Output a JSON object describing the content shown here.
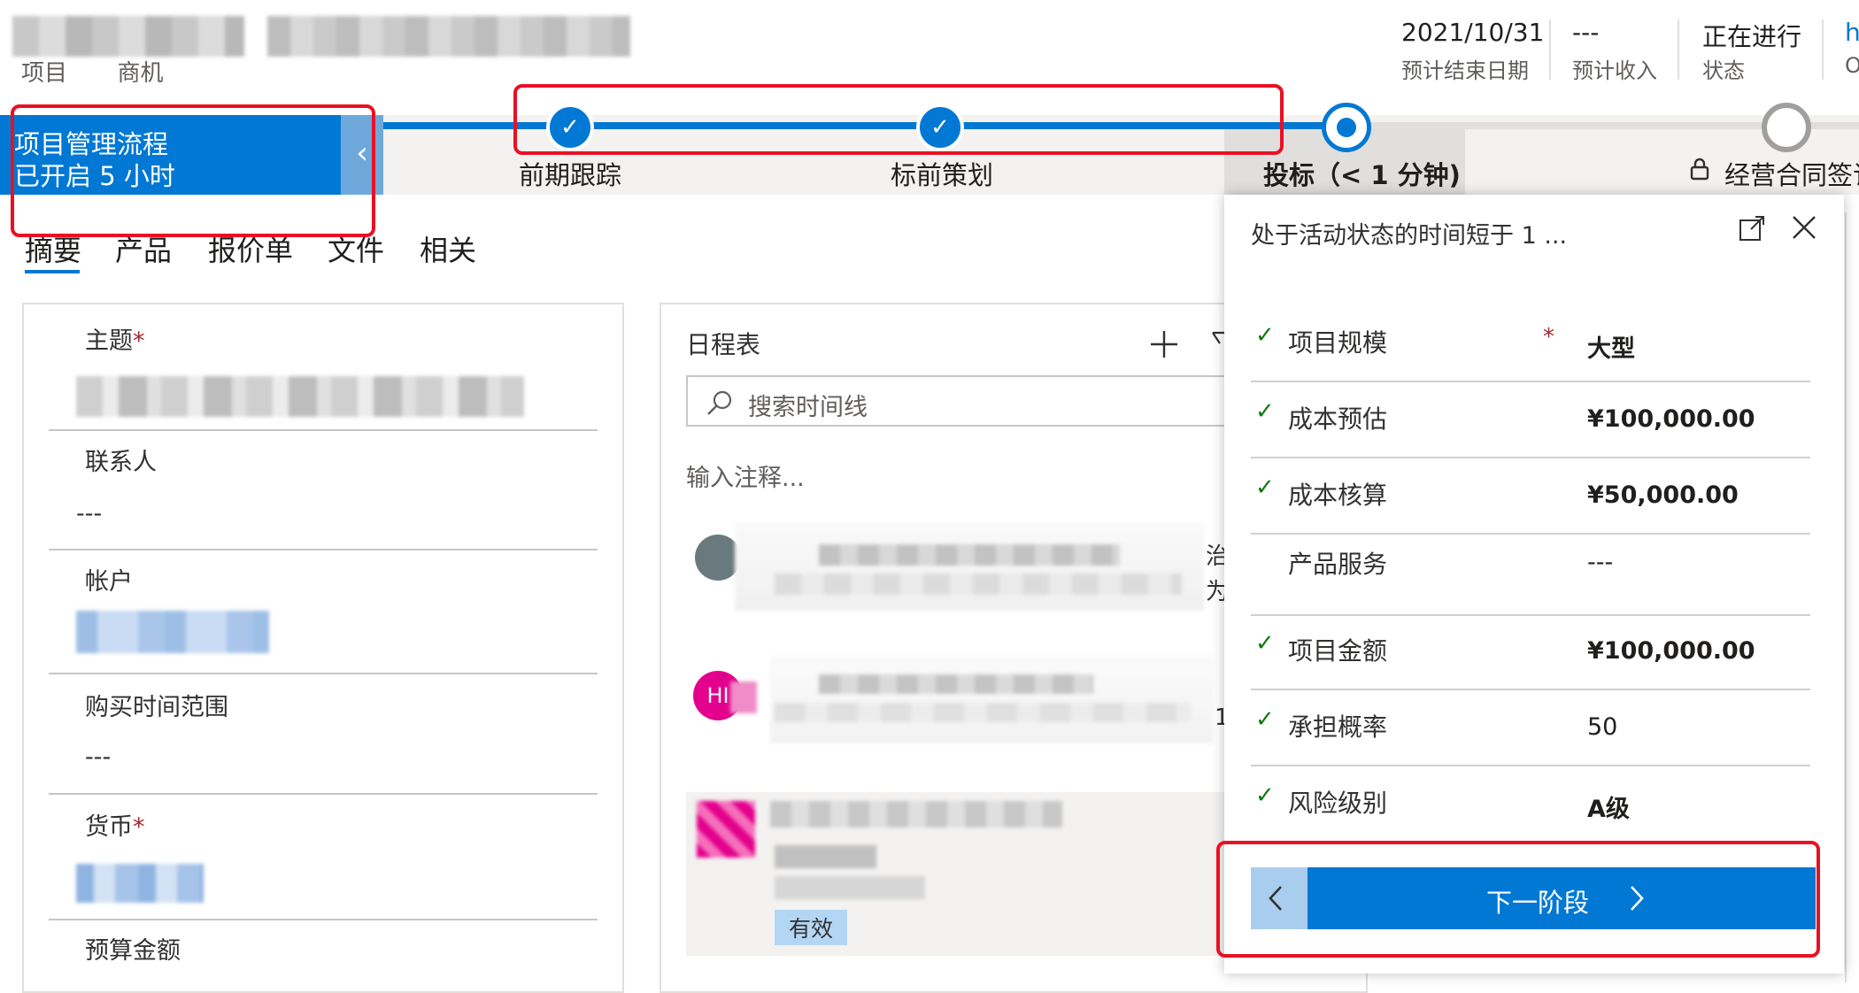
{
  "header": {
    "breadcrumb_entity": "项目",
    "breadcrumb_form": "商机",
    "fields": [
      {
        "value": "2021/10/31",
        "label": "预计结束日期"
      },
      {
        "value": "---",
        "label": "预计收入"
      },
      {
        "value": "正在进行",
        "label": "状态"
      },
      {
        "value": "h",
        "label": "O"
      }
    ]
  },
  "process": {
    "name": "项目管理流程",
    "duration": "已开启 5 小时",
    "stages": [
      {
        "label": "前期跟踪",
        "state": "completed"
      },
      {
        "label": "标前策划",
        "state": "completed"
      },
      {
        "label": "投标（< 1 分钟)",
        "state": "active"
      },
      {
        "label": "经营合同签订",
        "state": "locked"
      }
    ]
  },
  "tabs": [
    "摘要",
    "产品",
    "报价单",
    "文件",
    "相关"
  ],
  "summary_form": {
    "fields": [
      {
        "label": "主题",
        "required": true,
        "value": ""
      },
      {
        "label": "联系人",
        "required": false,
        "value": "---"
      },
      {
        "label": "帐户",
        "required": false,
        "value": ""
      },
      {
        "label": "购买时间范围",
        "required": false,
        "value": "---"
      },
      {
        "label": "货币",
        "required": true,
        "value": ""
      },
      {
        "label": "预算金额",
        "required": false,
        "value": ""
      }
    ]
  },
  "timeline": {
    "title": "日程表",
    "search_placeholder": "搜索时间线",
    "note_placeholder": "输入注释...",
    "items": [
      {
        "avatar": "",
        "avatar_color": "#69797e",
        "side_text_1": "治",
        "side_text_2": "为"
      },
      {
        "avatar": "HI",
        "avatar_color": "#e3008c",
        "side_text_1": "1",
        "side_text_2": ""
      },
      {
        "avatar": "",
        "avatar_color": "#e3008c",
        "badge": "有效"
      }
    ]
  },
  "stage_flyout": {
    "title": "处于活动状态的时间短于 1 ...",
    "fields": [
      {
        "label": "项目规模",
        "checked": true,
        "required": true,
        "value": "大型"
      },
      {
        "label": "成本预估",
        "checked": true,
        "required": false,
        "value": "¥100,000.00"
      },
      {
        "label": "成本核算",
        "checked": true,
        "required": false,
        "value": "¥50,000.00"
      },
      {
        "label": "产品服务",
        "checked": false,
        "required": false,
        "value": "---"
      },
      {
        "label": "项目金额",
        "checked": true,
        "required": false,
        "value": "¥100,000.00"
      },
      {
        "label": "承担概率",
        "checked": true,
        "required": false,
        "value": "50"
      },
      {
        "label": "风险级别",
        "checked": true,
        "required": false,
        "value": "A级"
      }
    ],
    "next_label": "下一阶段"
  },
  "colors": {
    "accent": "#0078d4",
    "annotation": "#e81123",
    "required": "#a4262c"
  }
}
